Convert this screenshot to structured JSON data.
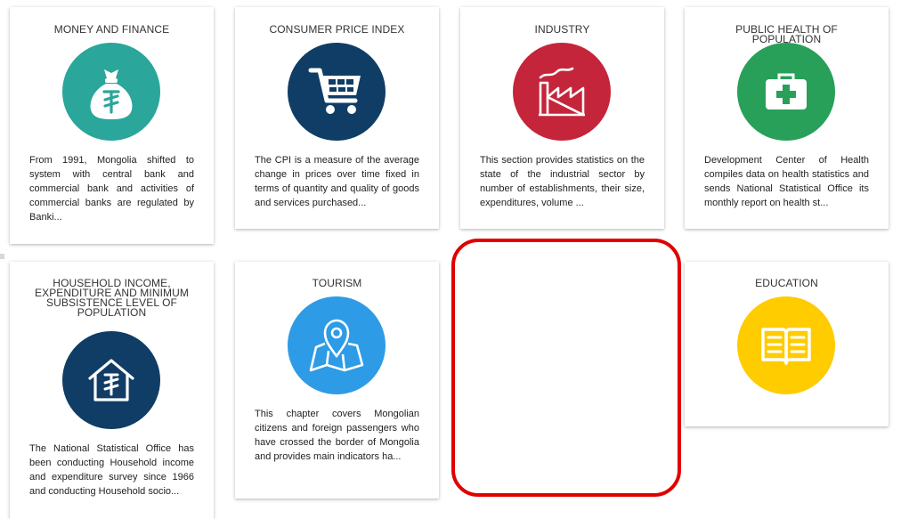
{
  "cards": [
    {
      "title": "MONEY AND FINANCE",
      "icon": "money-bag-icon",
      "color": "#2aa69b",
      "description": "From 1991, Mongolia shifted to system with central bank and commercial bank and activities of commercial banks are regulated by Banki..."
    },
    {
      "title": "CONSUMER PRICE INDEX",
      "icon": "shopping-cart-icon",
      "color": "#0f3d66",
      "description": "The CPI is a measure of the average change in prices over time fixed in terms of quantity and quality of goods and services purchased..."
    },
    {
      "title": "INDUSTRY",
      "icon": "factory-icon",
      "color": "#c4253a",
      "description": "This section provides statistics on the state of the industrial sector by number of establishments, their size, expenditures, volume ..."
    },
    {
      "title": "PUBLIC HEALTH OF POPULATION",
      "icon": "medical-kit-icon",
      "color": "#28a059",
      "description": "Development Center of Health compiles data on health statistics and sends National Statistical Office its monthly report on health st..."
    },
    {
      "title": "HOUSEHOLD INCOME, EXPENDITURE AND MINIMUM SUBSISTENCE LEVEL OF POPULATION",
      "icon": "house-tugrik-icon",
      "color": "#0f3d66",
      "description": "The National Statistical Office has been conducting Household income and expenditure survey since 1966 and conducting Household socio..."
    },
    {
      "title": "TOURISM",
      "icon": "map-pin-icon",
      "color": "#2d9be6",
      "description": "This chapter covers Mongolian citizens and foreign passengers who have crossed the border of Mongolia and provides main indicators ha..."
    },
    {
      "title": "EDUCATION",
      "icon": "open-book-icon",
      "color": "#ffcc00",
      "description": ""
    }
  ]
}
